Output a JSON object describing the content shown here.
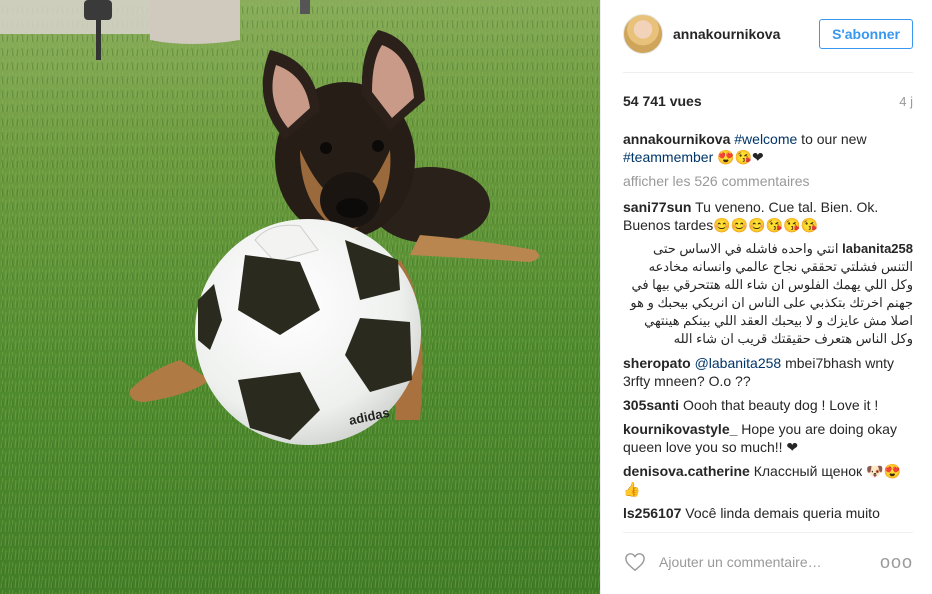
{
  "post": {
    "username": "annakournikova",
    "follow_label": "S'abonner",
    "views": "54 741 vues",
    "age": "4 j",
    "caption": {
      "user": "annakournikova",
      "tag1": "#welcome",
      "text1": " to our new",
      "tag2": "#teammember",
      "emoji": " 😍😘❤"
    },
    "show_more": "afficher les 526 commentaires",
    "comments": [
      {
        "user": "sani77sun",
        "text": "Tu veneno. Cue tal. Bien. Ok. Buenos tardes😊😊😊😘😘😘"
      },
      {
        "user": "labanita258",
        "text": "انتي واحده فاشله في الاساس حتى التنس فشلتي تحققي نجاح عالمي وانسانه مخادعه وكل اللي يهمك الفلوس ان شاء الله هتتحرقي بيها في جهنم اخرتك بتكذبي على الناس ان انريكي بيحبك و هو اصلا مش عايزك و لا بيحبك العقد اللي بينكم هينتهي وكل الناس هتعرف حقيقتك قريب ان شاء الله"
      },
      {
        "user": "sheropato",
        "mention": "@labanita258",
        "text": " mbei7bhash wnty 3rfty mneen? O.o ??"
      },
      {
        "user": "305santi",
        "text": "Oooh that beauty dog ! Love it !"
      },
      {
        "user": "kournikovastyle_",
        "text": "Hope you are doing okay queen love you so much!! ❤"
      },
      {
        "user": "denisova.catherine",
        "text": "Классный щенок 🐶😍👍"
      },
      {
        "user": "ls256107",
        "text": "Você linda demais queria muito"
      }
    ],
    "add_comment_placeholder": "Ajouter un commentaire…",
    "options_label": "ooo",
    "ball_brand": "adidas"
  },
  "colors": {
    "accent": "#3897f0",
    "text": "#262626",
    "muted": "#999999",
    "link": "#003569"
  }
}
